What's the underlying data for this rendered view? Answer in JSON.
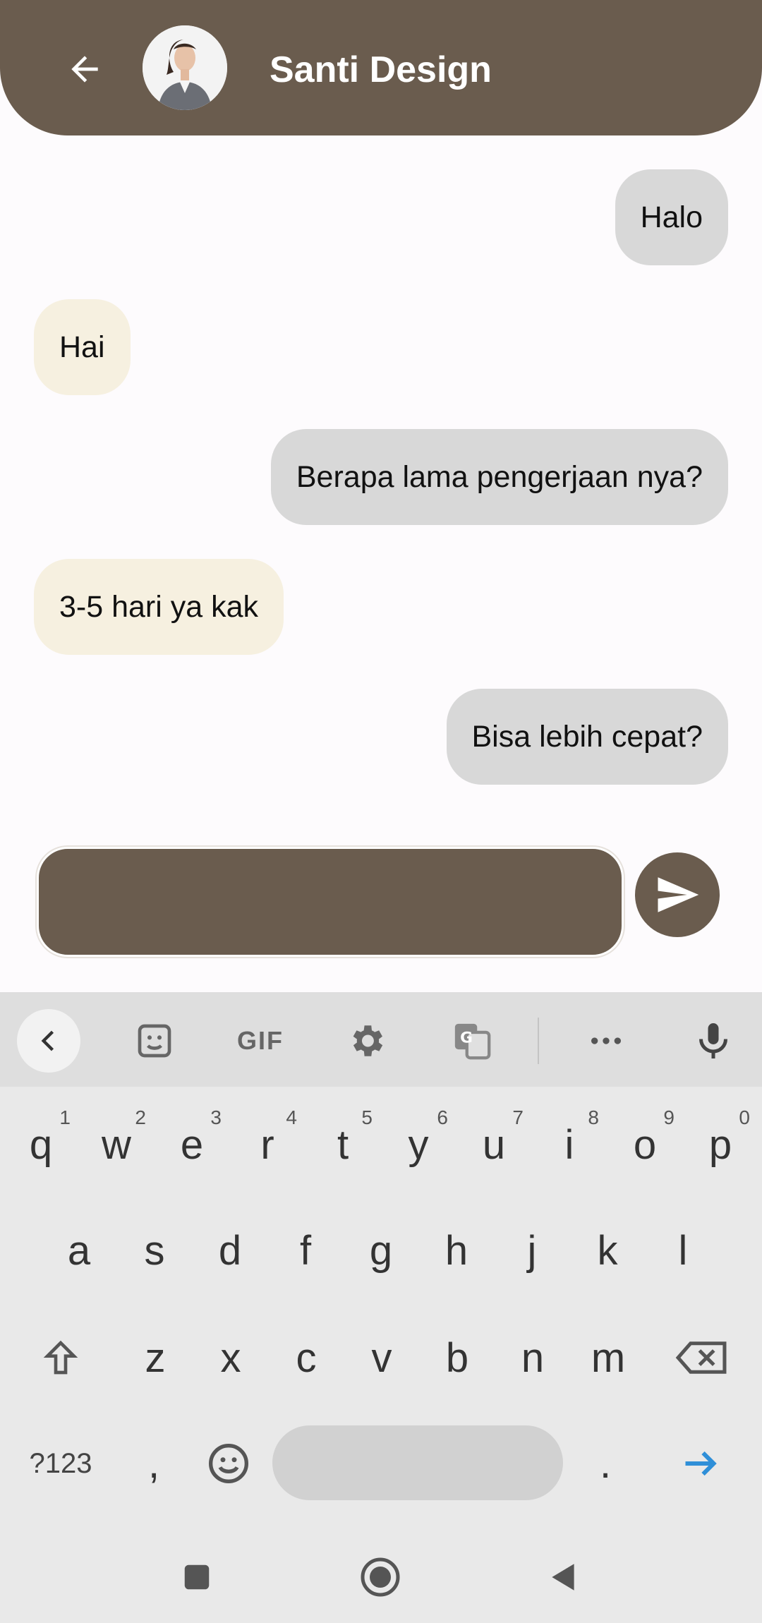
{
  "header": {
    "title": "Santi Design"
  },
  "messages": [
    {
      "text": "Halo",
      "side": "sent"
    },
    {
      "text": "Hai",
      "side": "received"
    },
    {
      "text": "Berapa lama pengerjaan nya?",
      "side": "sent"
    },
    {
      "text": "3-5 hari ya kak",
      "side": "received"
    },
    {
      "text": "Bisa lebih cepat?",
      "side": "sent"
    }
  ],
  "composer": {
    "value": ""
  },
  "keyboard": {
    "row1": [
      {
        "key": "q",
        "hint": "1"
      },
      {
        "key": "w",
        "hint": "2"
      },
      {
        "key": "e",
        "hint": "3"
      },
      {
        "key": "r",
        "hint": "4"
      },
      {
        "key": "t",
        "hint": "5"
      },
      {
        "key": "y",
        "hint": "6"
      },
      {
        "key": "u",
        "hint": "7"
      },
      {
        "key": "i",
        "hint": "8"
      },
      {
        "key": "o",
        "hint": "9"
      },
      {
        "key": "p",
        "hint": "0"
      }
    ],
    "row2": [
      "a",
      "s",
      "d",
      "f",
      "g",
      "h",
      "j",
      "k",
      "l"
    ],
    "row3": [
      "z",
      "x",
      "c",
      "v",
      "b",
      "n",
      "m"
    ],
    "symbols_label": "?123",
    "comma_label": ",",
    "period_label": ".",
    "toolbar_gif": "GIF"
  },
  "colors": {
    "brand": "#6a5c4e",
    "sent_bubble": "#d8d8d8",
    "received_bubble": "#f6f0e0",
    "enter_arrow": "#2f8fd8"
  }
}
